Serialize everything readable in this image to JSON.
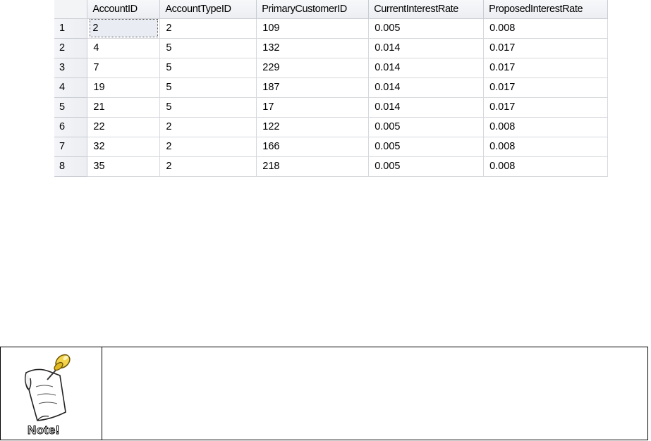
{
  "results_grid": {
    "columns": [
      "AccountID",
      "AccountTypeID",
      "PrimaryCustomerID",
      "CurrentInterestRate",
      "ProposedInterestRate"
    ],
    "rows": [
      {
        "num": "1",
        "cells": [
          "2",
          "2",
          "109",
          "0.005",
          "0.008"
        ]
      },
      {
        "num": "2",
        "cells": [
          "4",
          "5",
          "132",
          "0.014",
          "0.017"
        ]
      },
      {
        "num": "3",
        "cells": [
          "7",
          "5",
          "229",
          "0.014",
          "0.017"
        ]
      },
      {
        "num": "4",
        "cells": [
          "19",
          "5",
          "187",
          "0.014",
          "0.017"
        ]
      },
      {
        "num": "5",
        "cells": [
          "21",
          "5",
          "17",
          "0.014",
          "0.017"
        ]
      },
      {
        "num": "6",
        "cells": [
          "22",
          "2",
          "122",
          "0.005",
          "0.008"
        ]
      },
      {
        "num": "7",
        "cells": [
          "32",
          "2",
          "166",
          "0.005",
          "0.008"
        ]
      },
      {
        "num": "8",
        "cells": [
          "35",
          "2",
          "218",
          "0.005",
          "0.008"
        ]
      }
    ]
  },
  "note": {
    "icon": "pushpin-note-icon",
    "label": "Note!",
    "text": ""
  }
}
